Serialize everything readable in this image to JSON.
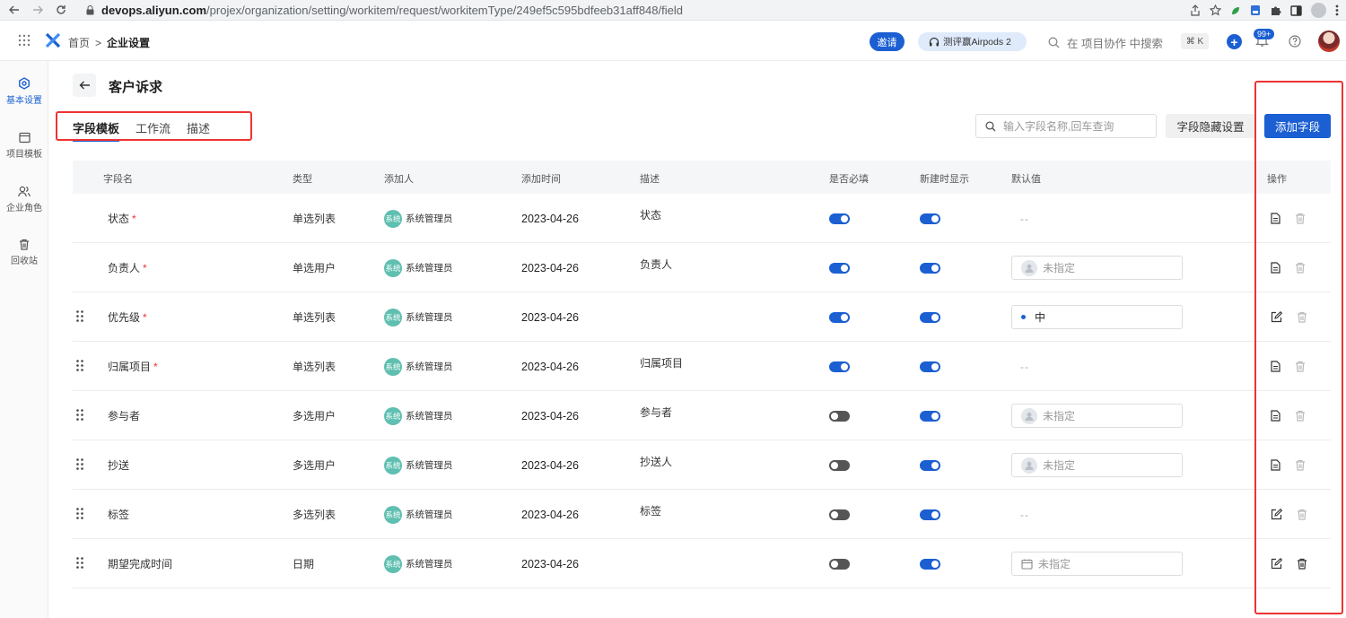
{
  "browser": {
    "url_host": "devops.aliyun.com",
    "url_path": "/projex/organization/setting/workitem/request/workitemType/249ef5c595bdfeeb31aff848/field"
  },
  "header": {
    "breadcrumb_home": "首页",
    "breadcrumb_sep": ">",
    "breadcrumb_current": "企业设置",
    "invite_label": "邀请",
    "promo_label": "测评赢Airpods 2",
    "search_placeholder": "在 项目协作 中搜索",
    "shortcut": "⌘ K",
    "notification_badge": "99+"
  },
  "sidebar": {
    "items": [
      {
        "label": "基本设置",
        "icon": "settings-hex-icon",
        "active": true
      },
      {
        "label": "项目模板",
        "icon": "template-icon",
        "active": false
      },
      {
        "label": "企业角色",
        "icon": "users-icon",
        "active": false
      },
      {
        "label": "回收站",
        "icon": "trash-icon",
        "active": false
      }
    ]
  },
  "page": {
    "title": "客户诉求",
    "tabs": [
      {
        "label": "字段模板",
        "active": true
      },
      {
        "label": "工作流",
        "active": false
      },
      {
        "label": "描述",
        "active": false
      }
    ],
    "search_placeholder": "输入字段名称,回车查询",
    "hide_fields_label": "字段隐藏设置",
    "add_field_label": "添加字段"
  },
  "table": {
    "columns": [
      "字段名",
      "类型",
      "添加人",
      "添加时间",
      "描述",
      "是否必填",
      "新建时显示",
      "默认值",
      "操作"
    ],
    "rows": [
      {
        "name": "状态",
        "required": true,
        "draggable": false,
        "type": "单选列表",
        "adder_avatar": "系统",
        "adder": "系统管理员",
        "date": "2023-04-26",
        "desc": "状态",
        "must": true,
        "show_on_create": true,
        "default_kind": "none",
        "default": "--",
        "op": "view"
      },
      {
        "name": "负责人",
        "required": true,
        "draggable": false,
        "type": "单选用户",
        "adder_avatar": "系统",
        "adder": "系统管理员",
        "date": "2023-04-26",
        "desc": "负责人",
        "must": true,
        "show_on_create": true,
        "default_kind": "user",
        "default": "未指定",
        "op": "view"
      },
      {
        "name": "优先级",
        "required": true,
        "draggable": true,
        "type": "单选列表",
        "adder_avatar": "系统",
        "adder": "系统管理员",
        "date": "2023-04-26",
        "desc": "",
        "must": true,
        "show_on_create": true,
        "default_kind": "priority",
        "default": "中",
        "op": "edit"
      },
      {
        "name": "归属项目",
        "required": true,
        "draggable": true,
        "type": "单选列表",
        "adder_avatar": "系统",
        "adder": "系统管理员",
        "date": "2023-04-26",
        "desc": "归属项目",
        "must": true,
        "show_on_create": true,
        "default_kind": "none",
        "default": "--",
        "op": "view"
      },
      {
        "name": "参与者",
        "required": false,
        "draggable": true,
        "type": "多选用户",
        "adder_avatar": "系统",
        "adder": "系统管理员",
        "date": "2023-04-26",
        "desc": "参与者",
        "must": false,
        "show_on_create": true,
        "default_kind": "user",
        "default": "未指定",
        "op": "view"
      },
      {
        "name": "抄送",
        "required": false,
        "draggable": true,
        "type": "多选用户",
        "adder_avatar": "系统",
        "adder": "系统管理员",
        "date": "2023-04-26",
        "desc": "抄送人",
        "must": false,
        "show_on_create": true,
        "default_kind": "user",
        "default": "未指定",
        "op": "view"
      },
      {
        "name": "标签",
        "required": false,
        "draggable": true,
        "type": "多选列表",
        "adder_avatar": "系统",
        "adder": "系统管理员",
        "date": "2023-04-26",
        "desc": "标签",
        "must": false,
        "show_on_create": true,
        "default_kind": "none",
        "default": "--",
        "op": "edit"
      },
      {
        "name": "期望完成时间",
        "required": false,
        "draggable": true,
        "type": "日期",
        "adder_avatar": "系统",
        "adder": "系统管理员",
        "date": "2023-04-26",
        "desc": "",
        "must": false,
        "show_on_create": true,
        "default_kind": "date",
        "default": "未指定",
        "op": "edit"
      }
    ]
  }
}
